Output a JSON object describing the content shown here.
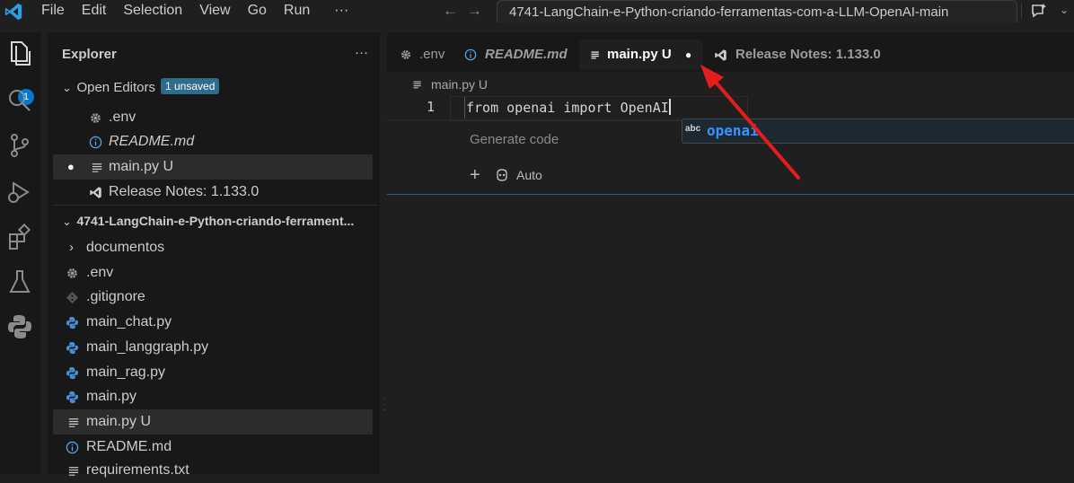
{
  "menu": [
    "File",
    "Edit",
    "Selection",
    "View",
    "Go",
    "Run",
    "···"
  ],
  "command_center": "4741-LangChain-e-Python-criando-ferramentas-com-a-LLM-OpenAI-main",
  "activity_badge": "1",
  "explorer": {
    "title": "Explorer",
    "more": "···",
    "open_editors": {
      "label": "Open Editors",
      "badge": "1 unsaved",
      "items": [
        {
          "label": ".env",
          "icon": "gear-icon"
        },
        {
          "label": "README.md",
          "icon": "info-icon"
        },
        {
          "label": "main.py U",
          "icon": "text-lines-icon",
          "dirty": true
        },
        {
          "label": "Release Notes: 1.133.0",
          "icon": "vscode-icon"
        }
      ]
    },
    "folder": {
      "label": "4741-LangChain-e-Python-criando-ferrament...",
      "items": [
        {
          "label": "documentos",
          "icon": "chevron-right-icon"
        },
        {
          "label": ".env",
          "icon": "gear-icon"
        },
        {
          "label": ".gitignore",
          "icon": "git-icon"
        },
        {
          "label": "main_chat.py",
          "icon": "python-icon"
        },
        {
          "label": "main_langgraph.py",
          "icon": "python-icon"
        },
        {
          "label": "main_rag.py",
          "icon": "python-icon"
        },
        {
          "label": "main.py",
          "icon": "python-icon"
        },
        {
          "label": "main.py U",
          "icon": "text-lines-icon"
        },
        {
          "label": "README.md",
          "icon": "info-icon"
        },
        {
          "label": "requirements.txt",
          "icon": "text-lines-icon"
        }
      ]
    }
  },
  "tabs": [
    {
      "label": ".env",
      "icon": "gear-icon"
    },
    {
      "label": "README.md",
      "icon": "info-icon"
    },
    {
      "label": "main.py U",
      "icon": "text-lines-icon",
      "active": true,
      "dirty_dot": "●"
    },
    {
      "label": "Release Notes: 1.133.0",
      "icon": "vscode-icon"
    }
  ],
  "breadcrumb": "main.py U",
  "editor": {
    "line_number": "1",
    "code": "from openai import OpenAI"
  },
  "inline_chat": {
    "placeholder": "Generate code",
    "plus": "+",
    "mode": "Auto"
  },
  "suggestion": {
    "kind": "abc",
    "label": "openai"
  },
  "colors": {
    "accent": "#0078d4",
    "suggestion_text": "#3794ff",
    "arrow": "#e51c1c"
  }
}
